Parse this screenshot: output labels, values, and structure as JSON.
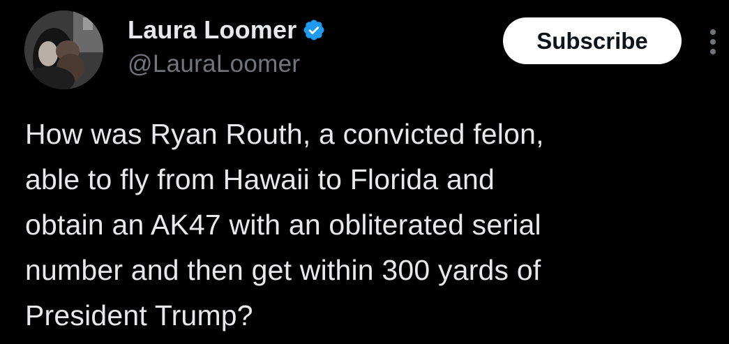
{
  "author": {
    "display_name": "Laura Loomer",
    "handle": "@LauraLoomer",
    "verified": true,
    "verified_color": "#1d9bf0"
  },
  "actions": {
    "subscribe_label": "Subscribe",
    "more_icon": "more-vertical-icon"
  },
  "tweet": {
    "text": "How was Ryan Routh, a convicted felon,\nable to fly from Hawaii to Florida and\nobtain an AK47 with an obliterated serial\nnumber and then get within 300 yards of\nPresident Trump?"
  },
  "colors": {
    "background": "#000000",
    "text_primary": "#e7e9ea",
    "text_secondary": "#71767b",
    "button_bg": "#ffffff",
    "button_text": "#0f1419"
  }
}
